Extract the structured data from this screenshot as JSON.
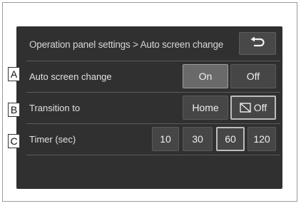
{
  "header": {
    "title": "Operation panel settings > Auto screen change",
    "back_icon": "return-arrow-icon"
  },
  "rows": [
    {
      "callout": "A",
      "label": "Auto screen change",
      "options": [
        "On",
        "Off"
      ],
      "selected": "On"
    },
    {
      "callout": "B",
      "label": "Transition to",
      "options": [
        "Home",
        "Off"
      ],
      "selected": "Off",
      "off_icon": "screen-off-icon"
    },
    {
      "callout": "C",
      "label": "Timer (sec)",
      "options": [
        "10",
        "30",
        "60",
        "120"
      ],
      "selected": "60"
    }
  ]
}
